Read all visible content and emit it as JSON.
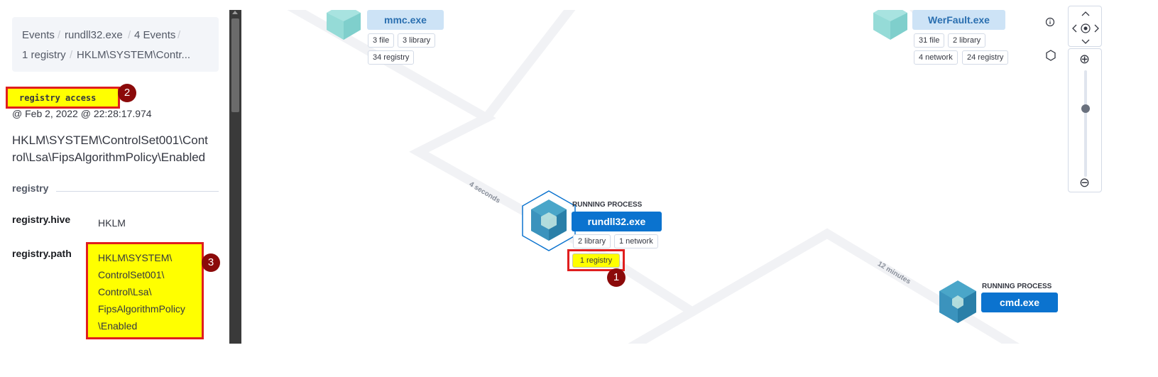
{
  "breadcrumb": {
    "items": [
      "Events",
      "rundll32.exe",
      "4 Events",
      "1 registry",
      "HKLM\\SYSTEM\\Contr..."
    ]
  },
  "event": {
    "type": "registry access",
    "timestamp": "@ Feb 2, 2022 @ 22:28:17.974",
    "description": "HKLM\\SYSTEM\\ControlSet001\\Control\\Lsa\\FipsAlgorithmPolicy\\Enabled"
  },
  "section": {
    "title": "registry"
  },
  "fields": [
    {
      "key": "registry.hive",
      "value": "HKLM"
    },
    {
      "key": "registry.path",
      "value_lines": [
        "HKLM\\SYSTEM\\",
        "ControlSet001\\",
        "Control\\Lsa\\",
        "FipsAlgorithmPolicy",
        "\\Enabled"
      ]
    }
  ],
  "badges": [
    "1",
    "2",
    "3"
  ],
  "graph": {
    "nodes": [
      {
        "name": "mmc.exe",
        "state": "dim",
        "label": "",
        "pills": [
          "3 file",
          "3 library",
          "34 registry"
        ]
      },
      {
        "name": "WerFault.exe",
        "state": "dim",
        "label": "",
        "pills": [
          "31 file",
          "2 library",
          "4 network",
          "24 registry"
        ]
      },
      {
        "name": "rundll32.exe",
        "state": "active",
        "label": "RUNNING PROCESS",
        "pills": [
          "2 library",
          "1 network",
          "1 registry"
        ]
      },
      {
        "name": "cmd.exe",
        "state": "active",
        "label": "RUNNING PROCESS",
        "pills": []
      }
    ],
    "edges": [
      {
        "label": "4 seconds"
      },
      {
        "label": "12 minutes"
      }
    ]
  },
  "controls": {
    "info_icon": "info-icon",
    "schema_icon": "hexagon-icon",
    "zoom_in": "⊕",
    "zoom_out": "⊖",
    "zoom_level": 0.65
  },
  "colors": {
    "highlight": "#ffff00",
    "highlight_border": "#e01e1e",
    "badge": "#8b0a0a",
    "active_process": "#0b73cf",
    "dim_process": "#cde3f6"
  }
}
